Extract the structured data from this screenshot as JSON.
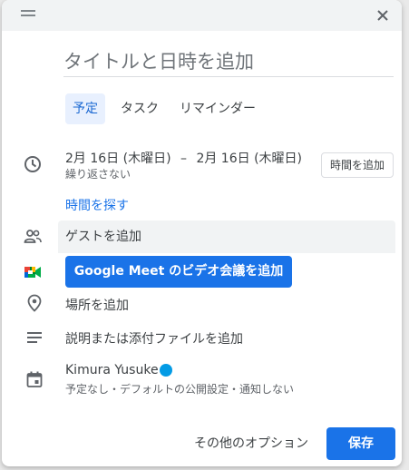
{
  "title_placeholder": "タイトルと日時を追加",
  "tabs": [
    {
      "label": "予定",
      "active": true
    },
    {
      "label": "タスク",
      "active": false
    },
    {
      "label": "リマインダー",
      "active": false
    }
  ],
  "datetime": {
    "start_date": "2月 16日 (木曜日)",
    "separator": "–",
    "end_date": "2月 16日 (木曜日)",
    "repeat": "繰り返さない",
    "add_time": "時間を追加"
  },
  "find_time": "時間を探す",
  "guests": {
    "label": "ゲストを追加"
  },
  "meet": {
    "label": "Google Meet のビデオ会議を追加"
  },
  "location": {
    "label": "場所を追加"
  },
  "description": {
    "label": "説明または添付ファイルを追加"
  },
  "calendar": {
    "owner": "Kimura Yusuke",
    "details": "予定なし・デフォルトの公開設定・通知しない",
    "color": "#039be5"
  },
  "footer": {
    "more_options": "その他のオプション",
    "save": "保存"
  },
  "colors": {
    "accent": "#1a73e8",
    "tab_active_bg": "#e8f0fe"
  }
}
